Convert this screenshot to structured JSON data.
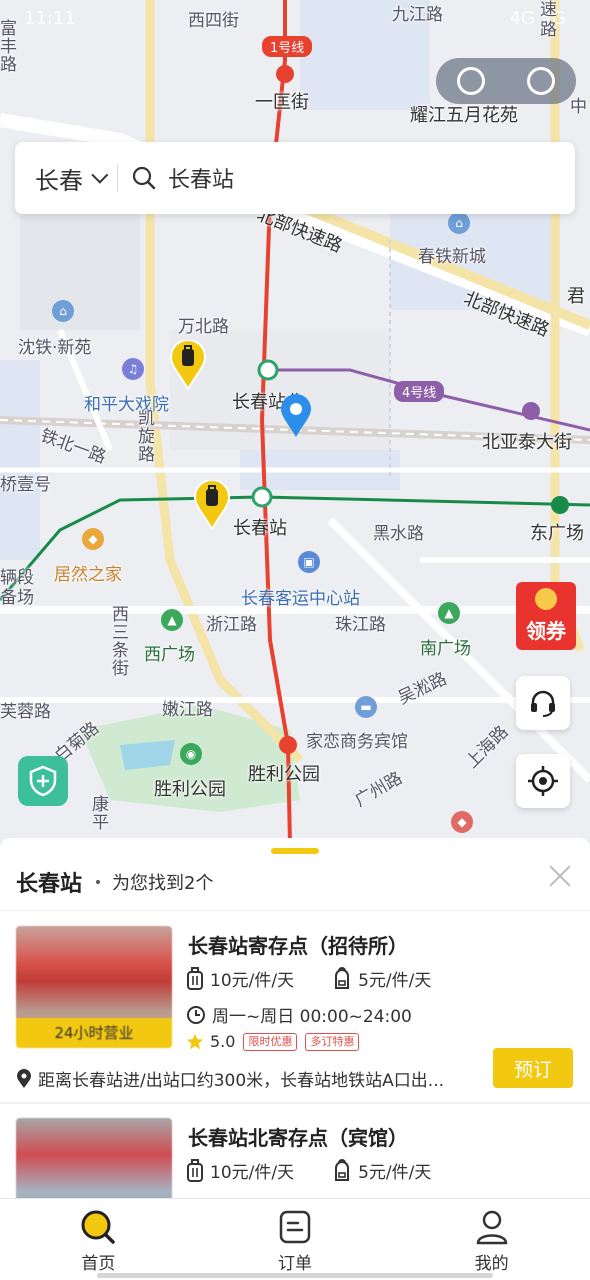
{
  "status_bar": {
    "left": "11:11",
    "right": "4G 5G"
  },
  "search": {
    "city": "长春",
    "query": "长春站"
  },
  "map": {
    "labels": {
      "road_1": "西四街",
      "road_2": "一匡街",
      "road_3": "耀江五月花苑",
      "road_4": "北部快速路",
      "road_5": "春铁新城",
      "road_6": "北部快速路",
      "road_7": "万北路",
      "road_8": "沈铁·新苑",
      "road_9": "和平大戏院",
      "road_10": "长春站北",
      "road_11": "北亚泰大街",
      "road_12": "铁北一路",
      "road_13": "凯旋路",
      "road_14": "桥壹号",
      "road_15": "长春站",
      "road_16": "黑水路",
      "road_17": "东广场",
      "road_18": "居然之家",
      "road_19": "长春客运中心站",
      "road_20": "浙江路",
      "road_21": "珠江路",
      "road_22": "南广场",
      "road_23": "西三条街",
      "road_24": "西广场",
      "road_25": "吴淞路",
      "road_26": "芙蓉路",
      "road_27": "嫩江路",
      "road_28": "家恋商务宾馆",
      "road_29": "上海路",
      "road_30": "广州路",
      "road_31": "胜利公园",
      "road_32": "胜利公园",
      "road_33": "康平",
      "road_34": "速路",
      "road_35": "中",
      "road_36": "君",
      "road_37": "辆段备场",
      "road_38": "富丰路",
      "road_39": "九江路",
      "road_40": "白菊路"
    },
    "line_tags": {
      "line1": "1号线",
      "line4": "4号线"
    },
    "coupon": "领券"
  },
  "results": {
    "title": "长春站",
    "count_text": "为您找到2个",
    "items": [
      {
        "name": "长春站寄存点（招待所）",
        "price_bag": "10元/件/天",
        "price_backpack": "5元/件/天",
        "hours": "周一~周日 00:00~24:00",
        "rating": "5.0",
        "tags": [
          "限时优惠",
          "多订特惠"
        ],
        "badge": "24小时营业",
        "distance": "距离长春站进/出站口约300米，长春站地铁站A口出...",
        "action": "预订"
      },
      {
        "name": "长春站北寄存点（宾馆）",
        "price_bag": "10元/件/天",
        "price_backpack": "5元/件/天"
      }
    ]
  },
  "nav": {
    "home": "首页",
    "orders": "订单",
    "mine": "我的"
  },
  "colors": {
    "accent": "#f2c811",
    "metro_red": "#e8412f",
    "metro_purple": "#8d5fa8",
    "metro_green": "#1a8a4a",
    "pin_blue": "#2b8ee8"
  }
}
